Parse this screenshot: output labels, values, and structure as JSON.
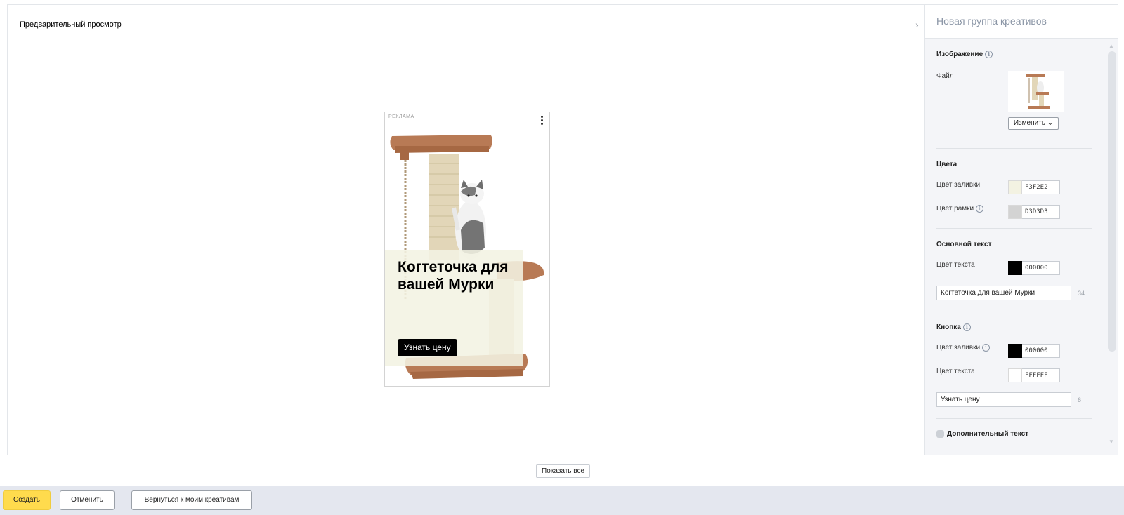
{
  "preview": {
    "title": "Предварительный просмотр",
    "collapse_icon": "chevron-right-icon"
  },
  "ad": {
    "label": "РЕКЛАМА",
    "menu_icon": "more-vertical-icon",
    "image": "cat-scratching-post-image",
    "headline": "Когтеточка для вашей Мурки",
    "button_text": "Узнать цену",
    "fill_color": "#F3F2E2",
    "border_color": "#D3D3D3",
    "text_color": "#000000",
    "button_fill": "#000000",
    "button_text_color": "#FFFFFF"
  },
  "panel": {
    "title": "Новая группа креативов",
    "image_section": {
      "title": "Изображение",
      "file_label": "Файл",
      "change_button": "Изменить"
    },
    "colors_section": {
      "title": "Цвета",
      "fill_label": "Цвет заливки",
      "fill_value": "F3F2E2",
      "border_label": "Цвет рамки",
      "border_value": "D3D3D3"
    },
    "main_text_section": {
      "title": "Основной текст",
      "text_color_label": "Цвет текста",
      "text_color_value": "000000",
      "text_value": "Когтеточка для вашей Мурки",
      "counter": "34"
    },
    "button_section": {
      "title": "Кнопка",
      "fill_label": "Цвет заливки",
      "fill_value": "000000",
      "text_color_label": "Цвет текста",
      "text_color_value": "FFFFFF",
      "text_value": "Узнать цену",
      "counter": "6"
    },
    "extra_text_label": "Дополнительный текст"
  },
  "show_all_button": "Показать все",
  "footer": {
    "create": "Создать",
    "cancel": "Отменить",
    "back": "Вернуться к моим креативам"
  },
  "colors": {
    "accent_yellow": "#FFDB4D",
    "footer_bg": "#E4E7EF",
    "panel_bg": "#F4F5F8"
  }
}
